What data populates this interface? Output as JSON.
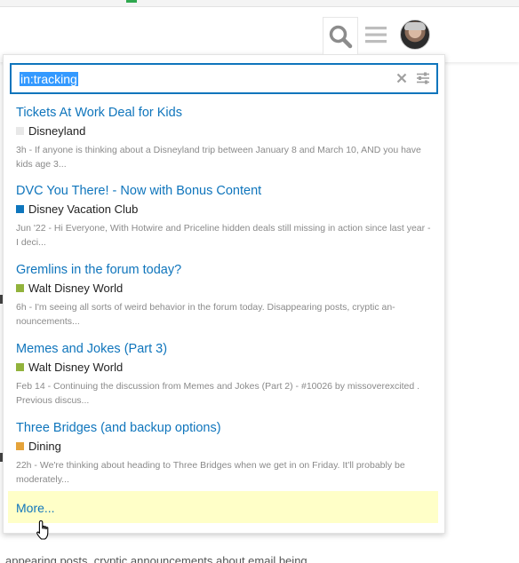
{
  "search": {
    "query": "in:tracking"
  },
  "results": [
    {
      "title": "Tickets At Work Deal for Kids",
      "category": "Disneyland",
      "category_color": "#e8e8e8",
      "blurb": "3h - If anyone is thinking about a Disneyland trip between January 8 and March 10, AND you have kids age 3..."
    },
    {
      "title": "DVC You There! - Now with Bonus Content",
      "category": "Disney Vacation Club",
      "category_color": "#0e76bd",
      "blurb": "Jun '22 - Hi Everyone, With Hotwire and Priceline hidden deals still missing in action since last year - I deci..."
    },
    {
      "title": "Gremlins in the forum today?",
      "category": "Walt Disney World",
      "category_color": "#92b33c",
      "blurb": "6h - I'm seeing all sorts of weird behavior in the forum today. Disappearing posts, cryptic an-nouncements..."
    },
    {
      "title": "Memes and Jokes (Part 3)",
      "category": "Walt Disney World",
      "category_color": "#92b33c",
      "blurb": "Feb 14 - Continuing the discussion from Memes and Jokes (Part 2) - #10026 by missoverexcited . Previous discus..."
    },
    {
      "title": "Three Bridges (and backup options)",
      "category": "Dining",
      "category_color": "#e5a33a",
      "blurb": "22h - We're thinking about heading to Three Bridges when we get in on Friday. It'll probably be moderately..."
    }
  ],
  "more_label": "More...",
  "background_text": "appearing posts, cryptic announcements about email being"
}
